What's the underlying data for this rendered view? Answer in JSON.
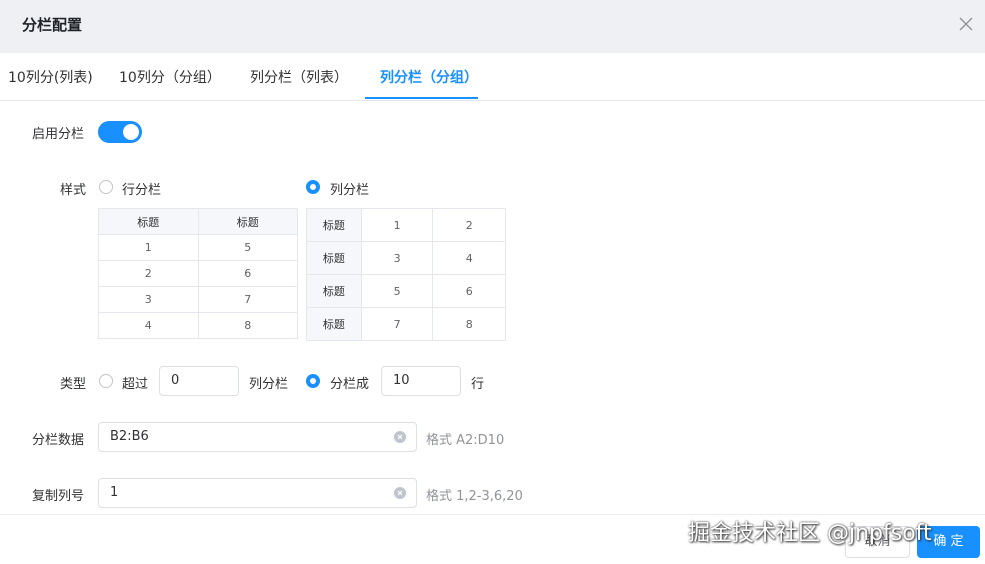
{
  "dialog": {
    "title": "分栏配置"
  },
  "tabs": [
    {
      "label": "10列分(列表)"
    },
    {
      "label": "10列分（分组）"
    },
    {
      "label": "列分栏（列表）"
    },
    {
      "label": "列分栏（分组）",
      "active": true
    }
  ],
  "form": {
    "enable": {
      "label": "启用分栏",
      "on": true
    },
    "style": {
      "label": "样式",
      "row_option": "行分栏",
      "col_option": "列分栏",
      "selected": "列分栏"
    },
    "row_preview": {
      "header": [
        "标题",
        "标题"
      ],
      "rows": [
        [
          "1",
          "5"
        ],
        [
          "2",
          "6"
        ],
        [
          "3",
          "7"
        ],
        [
          "4",
          "8"
        ]
      ]
    },
    "col_preview": {
      "rows": [
        {
          "head": "标题",
          "cells": [
            "1",
            "2"
          ]
        },
        {
          "head": "标题",
          "cells": [
            "3",
            "4"
          ]
        },
        {
          "head": "标题",
          "cells": [
            "5",
            "6"
          ]
        },
        {
          "head": "标题",
          "cells": [
            "7",
            "8"
          ]
        }
      ]
    },
    "type": {
      "label": "类型",
      "exceed_option": "超过",
      "exceed_value": "0",
      "exceed_suffix": "列分栏",
      "split_option": "分栏成",
      "split_value": "10",
      "split_suffix": "行",
      "selected": "分栏成"
    },
    "data_range": {
      "label": "分栏数据",
      "value": "B2:B6",
      "hint": "格式 A2:D10"
    },
    "copy_cols": {
      "label": "复制列号",
      "value": "1",
      "hint": "格式 1,2-3,6,20"
    }
  },
  "footer": {
    "cancel_label": "取消",
    "ok_label": "确 定"
  },
  "watermark": "掘金技术社区 @jnpfsoft",
  "colors": {
    "accent": "#1890ff",
    "header_bg": "#eef0f3",
    "border": "#dcdfe6"
  }
}
